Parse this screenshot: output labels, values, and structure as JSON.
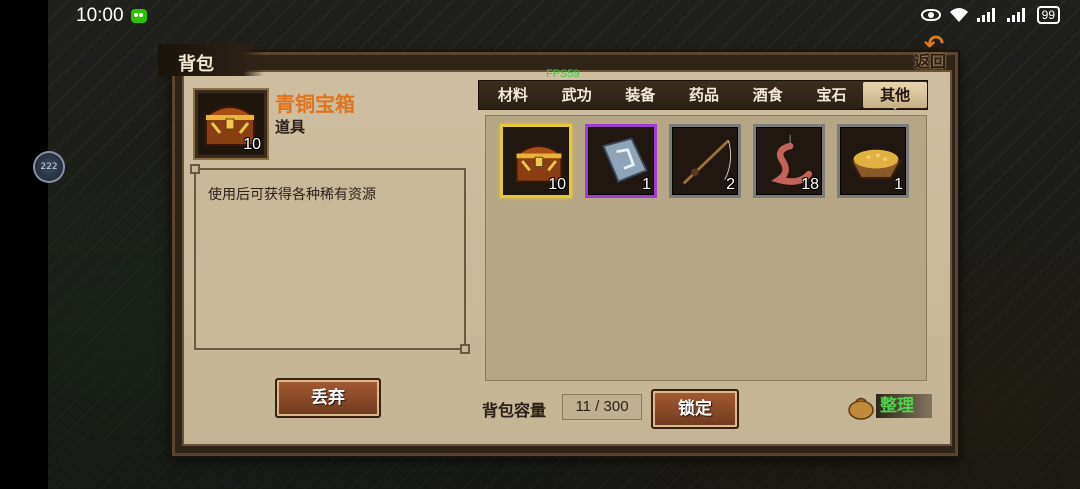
{
  "status_bar": {
    "time": "10:00",
    "battery": "99"
  },
  "float_ball": {
    "label": "222"
  },
  "panel": {
    "title": "背包",
    "back_label": "返回"
  },
  "selected_item": {
    "name": "青铜宝箱",
    "type": "道具",
    "count": "10",
    "description": "使用后可获得各种稀有资源",
    "icon": "treasure-chest-icon"
  },
  "buttons": {
    "discard": "丢弃",
    "lock": "锁定",
    "sort": "整理"
  },
  "fps_label": "FPS59",
  "tabs": [
    {
      "label": "材料"
    },
    {
      "label": "武功"
    },
    {
      "label": "装备"
    },
    {
      "label": "药品"
    },
    {
      "label": "酒食"
    },
    {
      "label": "宝石"
    },
    {
      "label": "其他",
      "active": true
    }
  ],
  "inventory": [
    {
      "icon": "treasure-chest-icon",
      "count": "10",
      "rarity": "gold"
    },
    {
      "icon": "stone-tablet-icon",
      "count": "1",
      "rarity": "purple"
    },
    {
      "icon": "fishing-rod-icon",
      "count": "2",
      "rarity": "gray"
    },
    {
      "icon": "earthworm-bait-icon",
      "count": "18",
      "rarity": "gray"
    },
    {
      "icon": "grain-basket-icon",
      "count": "1",
      "rarity": "gray"
    }
  ],
  "capacity": {
    "label": "背包容量",
    "value": "11 / 300"
  },
  "colors": {
    "item_name": "#e0731d",
    "fps": "#3fc83f",
    "sort_text": "#4ed34a",
    "rarity_gold": "#e6c63a",
    "rarity_purple": "#a23bd1",
    "rarity_gray": "#7c7c7c"
  }
}
